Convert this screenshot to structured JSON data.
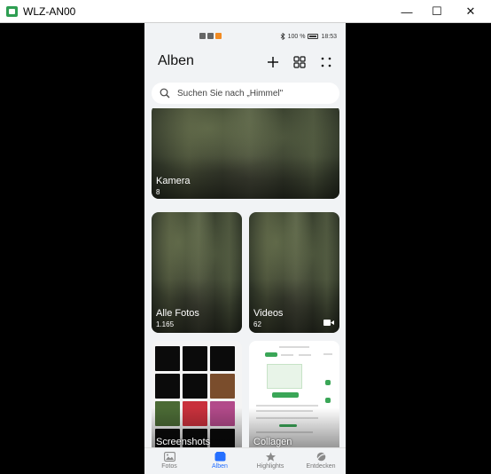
{
  "window": {
    "title": "WLZ-AN00",
    "minimize_glyph": "—",
    "maximize_glyph": "☐",
    "close_glyph": "✕"
  },
  "statusbar": {
    "battery": "100 %",
    "time": "18:53"
  },
  "header": {
    "title": "Alben"
  },
  "search": {
    "placeholder": "Suchen Sie nach „Himmel\""
  },
  "albums": [
    {
      "name": "Kamera",
      "count": "8"
    },
    {
      "name": "Alle Fotos",
      "count": "1.165"
    },
    {
      "name": "Videos",
      "count": "62"
    },
    {
      "name": "Screenshots",
      "count": ""
    },
    {
      "name": "Collagen",
      "count": ""
    }
  ],
  "bottom_nav": [
    {
      "label": "Fotos",
      "icon": "photo-icon"
    },
    {
      "label": "Alben",
      "icon": "album-icon",
      "active": true
    },
    {
      "label": "Highlights",
      "icon": "star-icon"
    },
    {
      "label": "Entdecken",
      "icon": "discover-icon"
    }
  ],
  "colors": {
    "accent": "#256fff",
    "phone_background": "#f1f3f5",
    "letterbox": "#000000"
  }
}
